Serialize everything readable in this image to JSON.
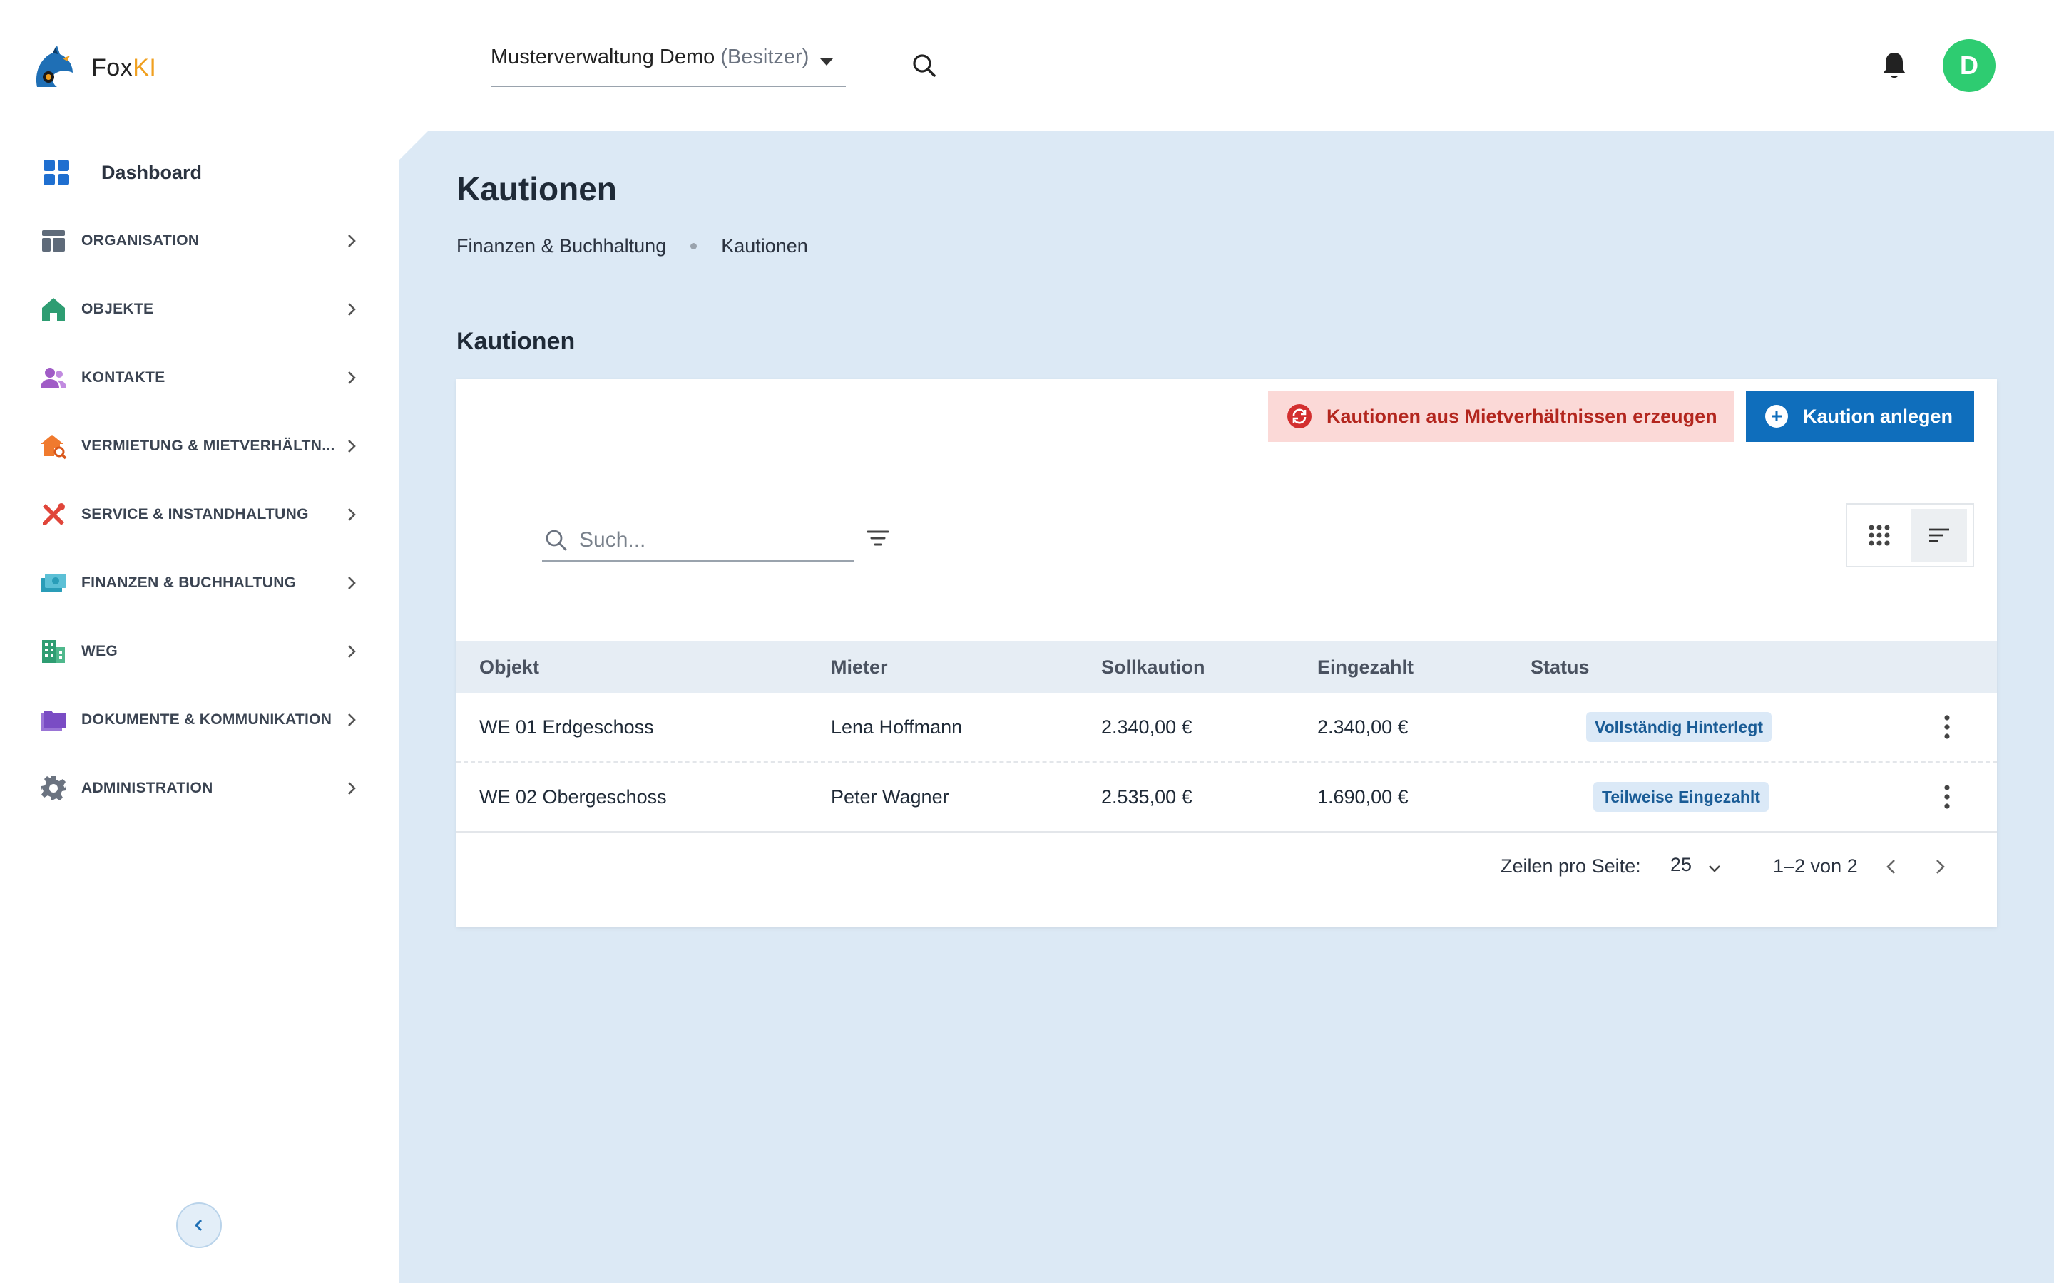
{
  "app": {
    "logo_prefix": "Fox",
    "logo_suffix": "KI"
  },
  "topbar": {
    "org_name": "Musterverwaltung Demo",
    "org_role": "(Besitzer)",
    "avatar_initial": "D"
  },
  "sidebar": {
    "dashboard": "Dashboard",
    "items": [
      {
        "label": "ORGANISATION",
        "icon": "layout-icon",
        "color": "#5f6b7a"
      },
      {
        "label": "OBJEKTE",
        "icon": "home-icon",
        "color": "#2e9d72"
      },
      {
        "label": "KONTAKTE",
        "icon": "people-icon",
        "color": "#a05cc6"
      },
      {
        "label": "VERMIETUNG & MIETVERHÄLTN...",
        "icon": "home-search-icon",
        "color": "#f07a2e"
      },
      {
        "label": "SERVICE & INSTANDHALTUNG",
        "icon": "tools-icon",
        "color": "#e0453a"
      },
      {
        "label": "FINANZEN & BUCHHALTUNG",
        "icon": "money-icon",
        "color": "#2a9db8"
      },
      {
        "label": "WEG",
        "icon": "building-icon",
        "color": "#2e9d72"
      },
      {
        "label": "DOKUMENTE & KOMMUNIKATION",
        "icon": "folders-icon",
        "color": "#7a4cc4"
      },
      {
        "label": "ADMINISTRATION",
        "icon": "gear-icon",
        "color": "#6b7380"
      }
    ]
  },
  "page": {
    "title": "Kautionen",
    "breadcrumb": [
      "Finanzen & Buchhaltung",
      "Kautionen"
    ],
    "section_title": "Kautionen"
  },
  "actions": {
    "generate_label": "Kautionen aus Mietverhältnissen erzeugen",
    "add_label": "Kaution anlegen"
  },
  "search": {
    "placeholder": "Such..."
  },
  "table": {
    "headers": [
      "Objekt",
      "Mieter",
      "Sollkaution",
      "Eingezahlt",
      "Status"
    ],
    "rows": [
      {
        "objekt": "WE 01 Erdgeschoss",
        "mieter": "Lena Hoffmann",
        "soll": "2.340,00 €",
        "eingezahlt": "2.340,00 €",
        "status": "Vollständig Hinterlegt"
      },
      {
        "objekt": "WE 02 Obergeschoss",
        "mieter": "Peter Wagner",
        "soll": "2.535,00 €",
        "eingezahlt": "1.690,00 €",
        "status": "Teilweise Eingezahlt"
      }
    ]
  },
  "pagination": {
    "rows_per_page_label": "Zeilen pro Seite:",
    "rows_per_page": "25",
    "range": "1–2 von 2"
  },
  "colors": {
    "primary": "#0f6ebc",
    "danger_bg": "#fbd9d7",
    "danger_text": "#b3261e",
    "main_bg": "#dce9f5",
    "avatar": "#2ecc71"
  }
}
